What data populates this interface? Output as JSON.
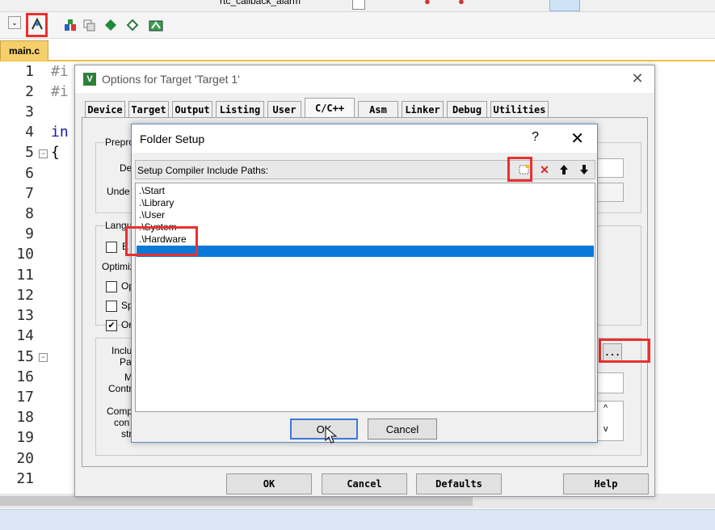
{
  "ide": {
    "top_toolbar_text": "rtc_callback_alarm",
    "file_tab": "main.c",
    "line_numbers": [
      "1",
      "2",
      "3",
      "4",
      "5",
      "6",
      "7",
      "8",
      "9",
      "10",
      "11",
      "12",
      "13",
      "14",
      "15",
      "16",
      "17",
      "18",
      "19",
      "20",
      "21"
    ],
    "code_fragments": [
      "#i",
      "#i",
      "in",
      "{"
    ]
  },
  "options_dialog": {
    "title": "Options for Target 'Target 1'",
    "close": "✕",
    "tabs": [
      "Device",
      "Target",
      "Output",
      "Listing",
      "User",
      "C/C++",
      "Asm",
      "Linker",
      "Debug",
      "Utilities"
    ],
    "active_tab": "C/C++",
    "partial_labels": {
      "preprocessor": "Prepro",
      "define": "De",
      "undefine": "Unde",
      "language": "Langu",
      "language_check": "E",
      "optimization": "Optimiz",
      "opt1": "Op",
      "opt2": "Sp",
      "opt3": "Or",
      "include": "Inclu",
      "paths": "Pa",
      "misc": "M",
      "controls": "Contr",
      "compiler": "Comp",
      "control": "con",
      "string": "str"
    },
    "browse_button": "...",
    "buttons": {
      "ok": "OK",
      "cancel": "Cancel",
      "defaults": "Defaults",
      "help": "Help"
    }
  },
  "folder_setup": {
    "title": "Folder Setup",
    "help": "?",
    "close": "✕",
    "header_label": "Setup Compiler Include Paths:",
    "paths": [
      ".\\Start",
      ".\\Library",
      ".\\User",
      ".\\System",
      ".\\Hardware"
    ],
    "buttons": {
      "ok": "OK",
      "cancel": "Cancel"
    }
  },
  "colors": {
    "highlight": "#e8312f",
    "selection": "#0a78d7",
    "tab_active": "#f5d06a"
  }
}
